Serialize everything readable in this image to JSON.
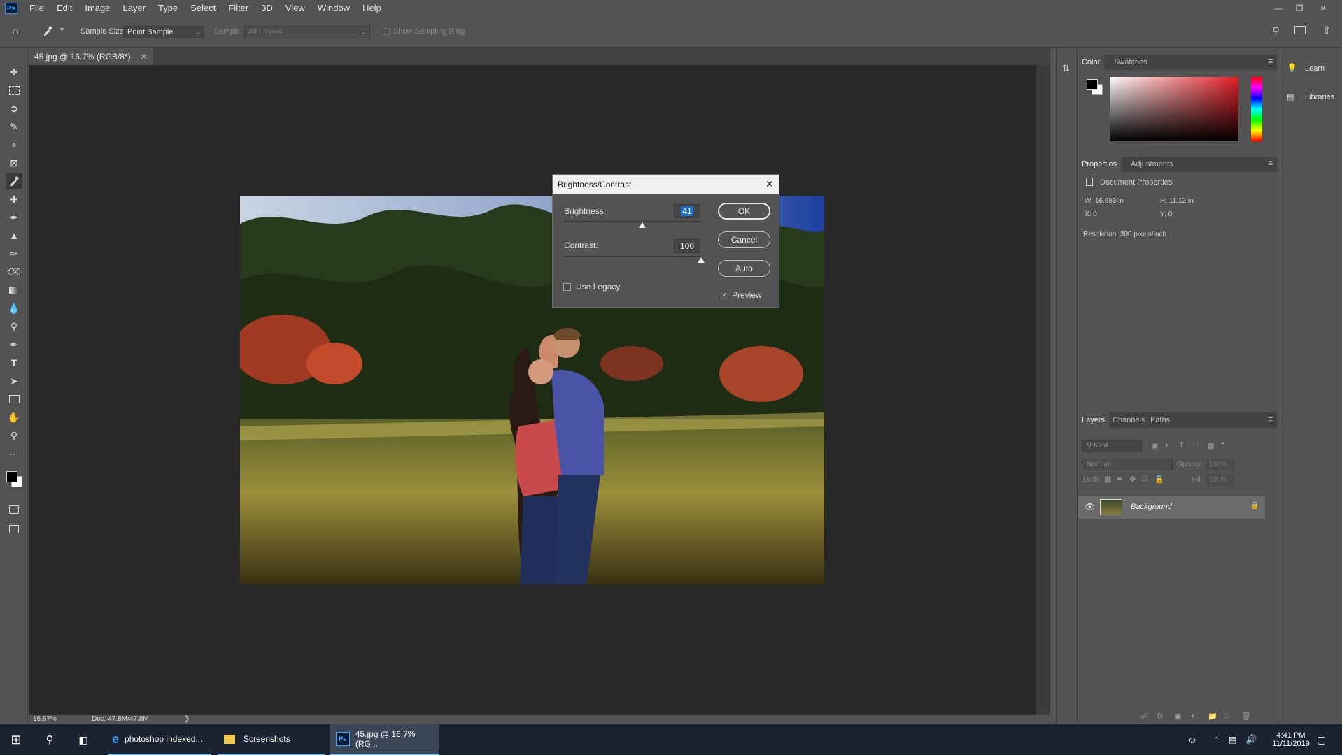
{
  "app": {
    "logo": "Ps",
    "menu": [
      "File",
      "Edit",
      "Image",
      "Layer",
      "Type",
      "Select",
      "Filter",
      "3D",
      "View",
      "Window",
      "Help"
    ]
  },
  "options_bar": {
    "sample_size_label": "Sample Size:",
    "sample_size_value": "Point Sample",
    "sample_label": "Sample:",
    "sample_value": "All Layers",
    "show_sampling_ring": "Show Sampling Ring"
  },
  "document": {
    "tab_title": "45.jpg @ 16.7% (RGB/8*)",
    "zoom": "16.67%",
    "doc_size": "Doc: 47.8M/47.8M"
  },
  "dialog": {
    "title": "Brightness/Contrast",
    "brightness_label": "Brightness:",
    "brightness_value": "41",
    "brightness_fraction": 0.57,
    "contrast_label": "Contrast:",
    "contrast_value": "100",
    "contrast_fraction": 1.0,
    "ok": "OK",
    "cancel": "Cancel",
    "auto": "Auto",
    "use_legacy": "Use Legacy",
    "use_legacy_checked": false,
    "preview": "Preview",
    "preview_checked": true
  },
  "color_panel": {
    "tabs": [
      "Color",
      "Swatches"
    ],
    "hue_color": "#e21f26"
  },
  "properties_panel": {
    "tabs": [
      "Properties",
      "Adjustments"
    ],
    "section": "Document Properties",
    "w": "W:  16.693 in",
    "h": "H:  11.12 in",
    "x": "X:  0",
    "y": "Y:  0",
    "resolution": "Resolution: 300 pixels/inch"
  },
  "layers_panel": {
    "tabs": [
      "Layers",
      "Channels",
      "Paths"
    ],
    "filter_placeholder": "Kind",
    "blend_mode": "Normal",
    "opacity_label": "Opacity:",
    "opacity_value": "100%",
    "lock_label": "Lock:",
    "fill_label": "Fill:",
    "fill_value": "100%",
    "layer_name": "Background"
  },
  "learn_panel": {
    "learn": "Learn",
    "libraries": "Libraries"
  },
  "taskbar": {
    "edge_item": "photoshop indexed...",
    "explorer_item": "Screenshots",
    "ps_item": "45.jpg @ 16.7% (RG...",
    "time": "4:41 PM",
    "date": "11/11/2019"
  }
}
